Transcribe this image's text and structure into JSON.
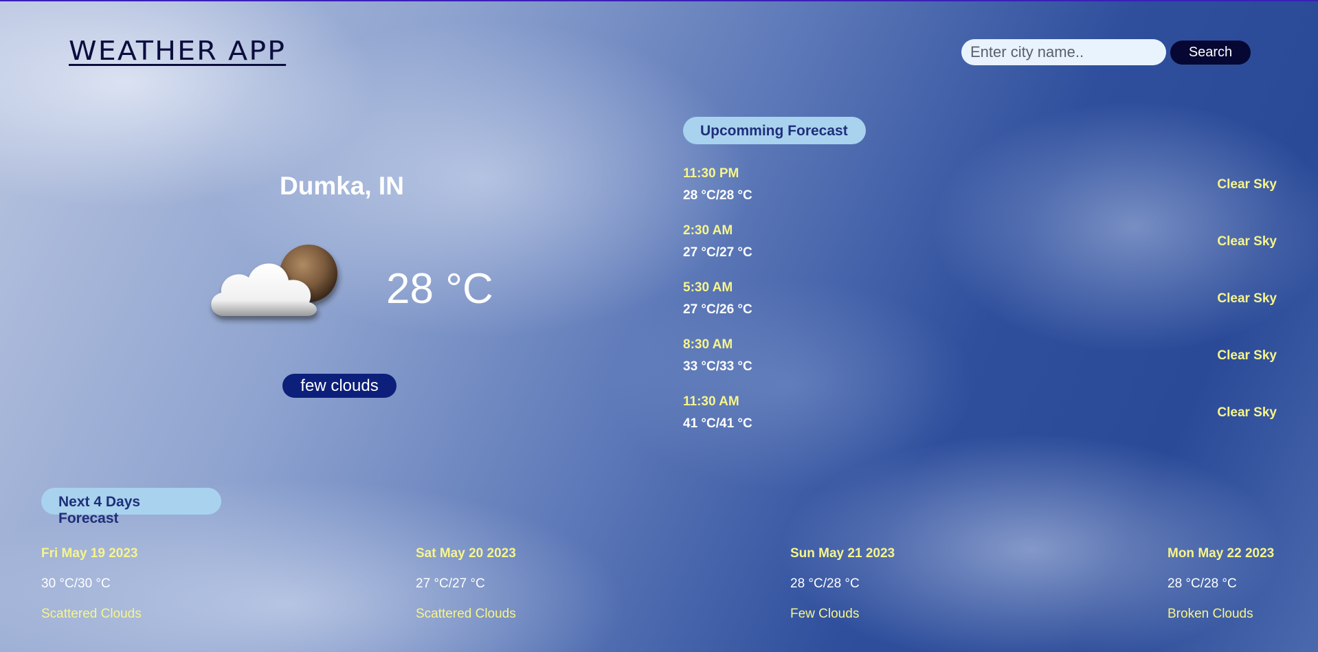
{
  "header": {
    "app_title": "WEATHER APP",
    "search_placeholder": "Enter city name..",
    "search_button": "Search"
  },
  "current": {
    "city": "Dumka, IN",
    "icon": "few-clouds-icon",
    "temperature": "28 °C",
    "description": "few clouds"
  },
  "upcoming": {
    "heading": "Upcomming Forecast",
    "items": [
      {
        "time": "11:30 PM",
        "temp": "28 °C/28 °C",
        "condition": "Clear Sky"
      },
      {
        "time": "2:30 AM",
        "temp": "27 °C/27 °C",
        "condition": "Clear Sky"
      },
      {
        "time": "5:30 AM",
        "temp": "27 °C/26 °C",
        "condition": "Clear Sky"
      },
      {
        "time": "8:30 AM",
        "temp": "33 °C/33 °C",
        "condition": "Clear Sky"
      },
      {
        "time": "11:30 AM",
        "temp": "41 °C/41 °C",
        "condition": "Clear Sky"
      }
    ]
  },
  "next_days": {
    "heading": "Next 4 Days Forecast",
    "days": [
      {
        "date": "Fri May 19 2023",
        "temp": "30 °C/30 °C",
        "condition": "Scattered Clouds"
      },
      {
        "date": "Sat May 20 2023",
        "temp": "27 °C/27 °C",
        "condition": "Scattered Clouds"
      },
      {
        "date": "Sun May 21 2023",
        "temp": "28 °C/28 °C",
        "condition": "Few Clouds"
      },
      {
        "date": "Mon May 22 2023",
        "temp": "28 °C/28 °C",
        "condition": "Broken Clouds"
      }
    ]
  },
  "colors": {
    "accent_yellow": "#f7f58a",
    "pill_blue": "#a9d2ee",
    "badge_navy": "#0c1f7a",
    "title_navy": "#0b0d3e"
  }
}
